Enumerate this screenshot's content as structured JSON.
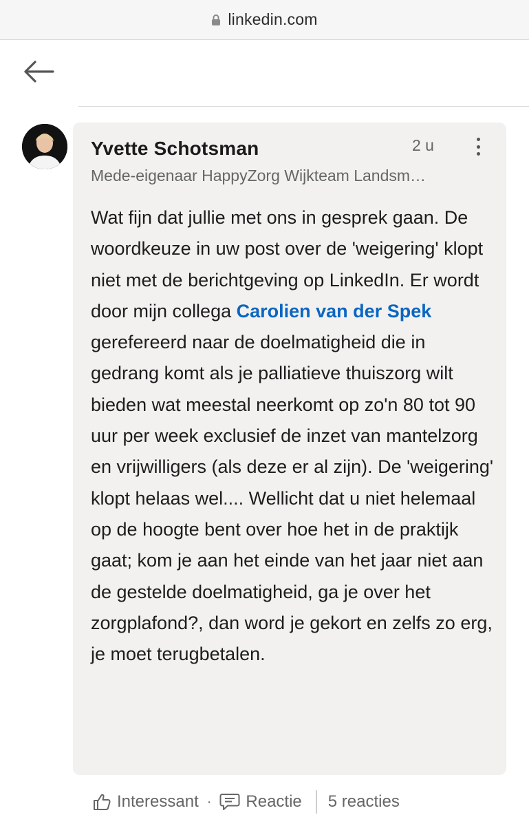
{
  "browser": {
    "url": "linkedin.com"
  },
  "comment": {
    "author": "Yvette Schotsman",
    "time": "2 u",
    "headline": "Mede-eigenaar HappyZorg Wijkteam Landsm…",
    "text_before_mention": "Wat fijn dat jullie met ons in gesprek gaan. De woordkeuze in uw post over de 'weigering' klopt niet met de berichtgeving op LinkedIn. Er wordt door mijn collega ",
    "mention": "Carolien van der Spek",
    "text_after_mention": " gerefereerd naar de doelmatigheid die in gedrang komt als je palliatieve thuiszorg wilt bieden wat meestal neerkomt op zo'n 80 tot 90 uur per week exclusief de inzet van mantelzorg en vrijwilligers (als deze er al zijn). De 'weigering' klopt helaas wel.... Wellicht dat u niet helemaal op de hoogte bent over hoe het in de praktijk gaat; kom je aan het einde van het jaar niet aan de gestelde doelmatigheid, ga je over het zorgplafond?, dan word je gekort en zelfs zo erg, je moet terugbetalen."
  },
  "actions": {
    "like_label": "Interessant",
    "separator": "·",
    "reply_label": "Reactie",
    "replies_count": "5 reacties"
  },
  "icons": {
    "lock": "lock-icon",
    "back": "back-arrow-icon",
    "more": "more-vertical-icon",
    "like": "thumbs-up-icon",
    "reply": "speech-bubble-icon"
  },
  "colors": {
    "mention": "#0a66c2",
    "bubble_bg": "#f2f1ef",
    "secondary_text": "#666666"
  }
}
